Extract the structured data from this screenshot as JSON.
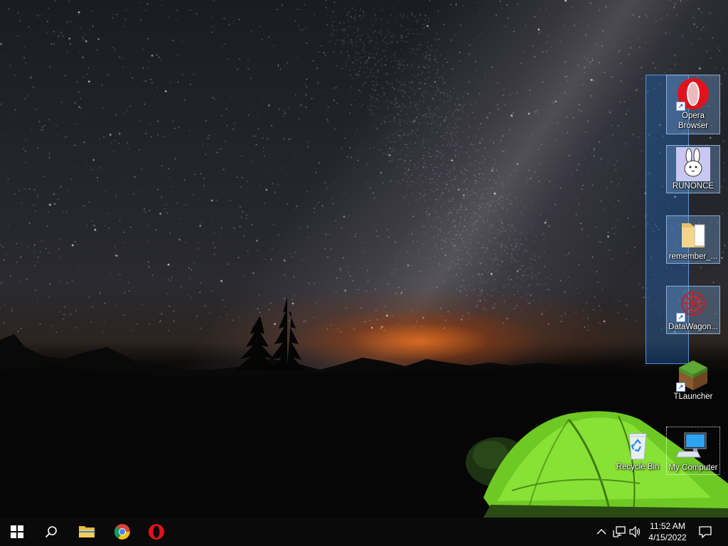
{
  "desktop": {
    "icons": [
      {
        "id": "opera",
        "label": "Opera Browser",
        "icon": "opera-icon"
      },
      {
        "id": "runonce",
        "label": "RUNONCE",
        "icon": "bunny-icon"
      },
      {
        "id": "remember",
        "label": "remember_...",
        "icon": "folder-icon"
      },
      {
        "id": "datawagon",
        "label": "DataWagon...",
        "icon": "datawagon-icon"
      },
      {
        "id": "tlauncher",
        "label": "TLauncher",
        "icon": "grass-block-icon"
      },
      {
        "id": "recycle",
        "label": "Recycle Bin",
        "icon": "recycle-bin-icon"
      },
      {
        "id": "mycomputer",
        "label": "My Computer",
        "icon": "computer-icon"
      }
    ]
  },
  "taskbar": {
    "pinned": [
      {
        "name": "start",
        "icon": "windows-logo-icon"
      },
      {
        "name": "search",
        "icon": "search-icon"
      },
      {
        "name": "file-explorer",
        "icon": "folder-icon"
      },
      {
        "name": "chrome",
        "icon": "chrome-icon"
      },
      {
        "name": "opera",
        "icon": "opera-icon"
      }
    ],
    "tray": {
      "icons": [
        "chevron-up-icon",
        "network-icon",
        "volume-icon",
        "notification-icon"
      ],
      "time": "11:52 AM",
      "date": "4/15/2022"
    }
  },
  "colors": {
    "taskbar": "#0a0a0a",
    "selection": "#1e6ec8",
    "tent": "#7ddc2a"
  }
}
